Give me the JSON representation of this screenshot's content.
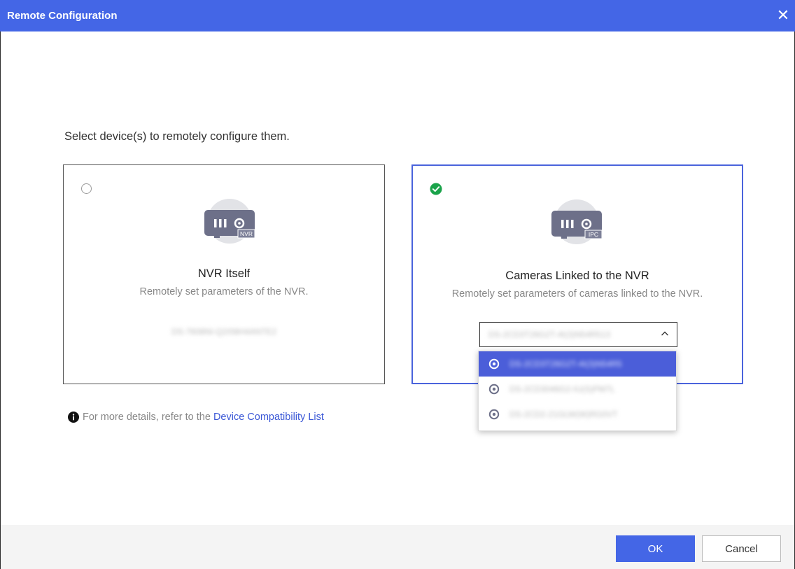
{
  "window": {
    "title": "Remote Configuration"
  },
  "prompt": "Select device(s) to remotely configure them.",
  "cards": {
    "nvr": {
      "selected": false,
      "badge": "NVR",
      "title": "NVR Itself",
      "description": "Remotely set parameters of the NVR.",
      "device": "DS-7608NI-Q2/08H4ANTE2"
    },
    "ipc": {
      "selected": true,
      "badge": "IPC",
      "title": "Cameras Linked to the NVR",
      "description": "Remotely set parameters of cameras linked to the NVR.",
      "selected_device": "DS-2CD3T26G2T-4I(3)N54R513"
    }
  },
  "dropdown": {
    "items": [
      {
        "label": "DS-2CD3T26G2T-4I(3)N54R5",
        "selected": true
      },
      {
        "label": "DS-2CD3046G2-IU(S)PM7L",
        "selected": false
      },
      {
        "label": "DS-2CD2-21GLW(W)RG0VT",
        "selected": false
      }
    ]
  },
  "info": {
    "text": "For more details, refer to the",
    "link": "Device Compatibility List"
  },
  "buttons": {
    "ok": "OK",
    "cancel": "Cancel"
  },
  "colors": {
    "accent": "#4466e6",
    "selected_border": "#4a63dc",
    "check_green": "#1aa34a",
    "device_icon": "#6d7089"
  },
  "icons": {
    "close": "close-icon",
    "check": "check-circle-icon",
    "nvr": "nvr-device-icon",
    "ipc": "ipc-device-icon",
    "camera": "camera-icon",
    "chevron": "chevron-up-icon",
    "info": "info-icon"
  }
}
